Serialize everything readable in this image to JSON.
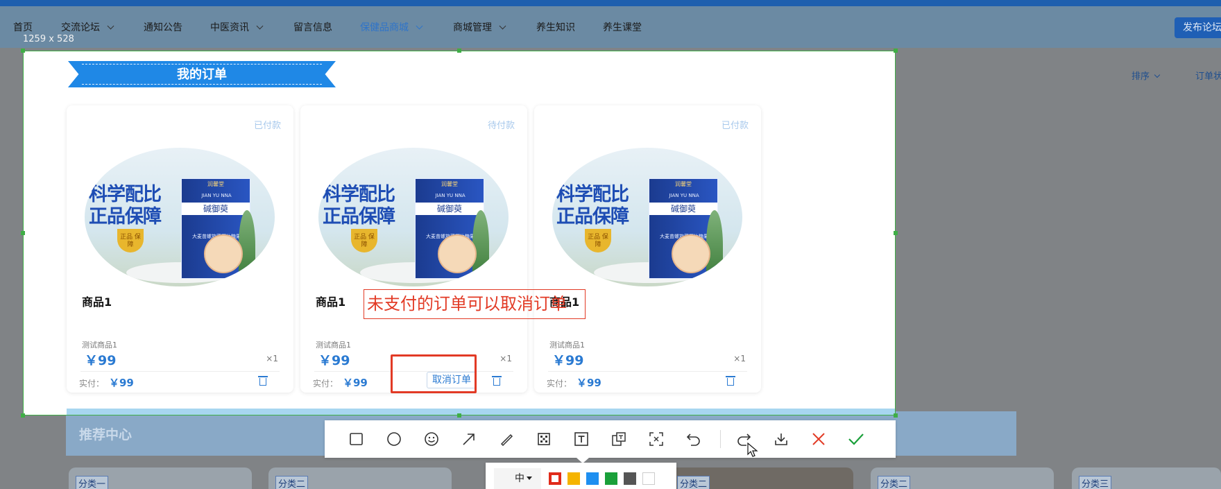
{
  "nav": {
    "items": [
      {
        "label": "首页",
        "has_dropdown": false
      },
      {
        "label": "交流论坛",
        "has_dropdown": true
      },
      {
        "label": "通知公告",
        "has_dropdown": false
      },
      {
        "label": "中医资讯",
        "has_dropdown": true
      },
      {
        "label": "留言信息",
        "has_dropdown": false
      },
      {
        "label": "保健品商城",
        "has_dropdown": true,
        "active": true
      },
      {
        "label": "商城管理",
        "has_dropdown": true
      },
      {
        "label": "养生知识",
        "has_dropdown": false
      },
      {
        "label": "养生课堂",
        "has_dropdown": false
      }
    ],
    "publish_label": "发布论坛"
  },
  "page": {
    "sort_label": "排序",
    "order_status_label": "订单状"
  },
  "capture": {
    "size_label": "1259 x 528"
  },
  "orders": {
    "title": "我的订单",
    "cards": [
      {
        "status": "已付款",
        "name": "商品1",
        "desc": "测试商品1",
        "price": "￥99",
        "qty": "×1",
        "paid_label": "实付：",
        "paid_value": "￥99",
        "cancel_label": ""
      },
      {
        "status": "待付款",
        "name": "商品1",
        "desc": "测试商品1",
        "price": "￥99",
        "qty": "×1",
        "paid_label": "实付：",
        "paid_value": "￥99",
        "cancel_label": "取消订单"
      },
      {
        "status": "已付款",
        "name": "商品1",
        "desc": "测试商品1",
        "price": "￥99",
        "qty": "×1",
        "paid_label": "实付：",
        "paid_value": "￥99",
        "cancel_label": ""
      }
    ],
    "product_image": {
      "headline_1": "科学配比",
      "headline_2": "正品保障",
      "seal": "正品 保障",
      "brand": "润馨堂",
      "box_name": "碱御萸",
      "box_latin": "JIAN YU NNA",
      "box_sub": "大麦苗螺旋藻压片糖果"
    }
  },
  "annotation": {
    "text": "未支付的订单可以取消订单"
  },
  "recommend": {
    "title": "推荐中心",
    "tags": [
      "分类一",
      "分类二",
      "分类二",
      "分类二",
      "分类三"
    ]
  },
  "toolbar": {
    "tools": [
      "rectangle-tool",
      "ellipse-tool",
      "emoji-tool",
      "arrow-tool",
      "pen-tool",
      "mosaic-tool",
      "text-tool",
      "translate-tool",
      "ocr-tool",
      "undo",
      "redo",
      "save",
      "cancel",
      "confirm"
    ],
    "size_value": "中",
    "colors": [
      "#e02b1a",
      "#f5b400",
      "#1e8ff0",
      "#1aa03a",
      "#555555",
      "#ffffff"
    ],
    "selected_color_index": 0
  }
}
